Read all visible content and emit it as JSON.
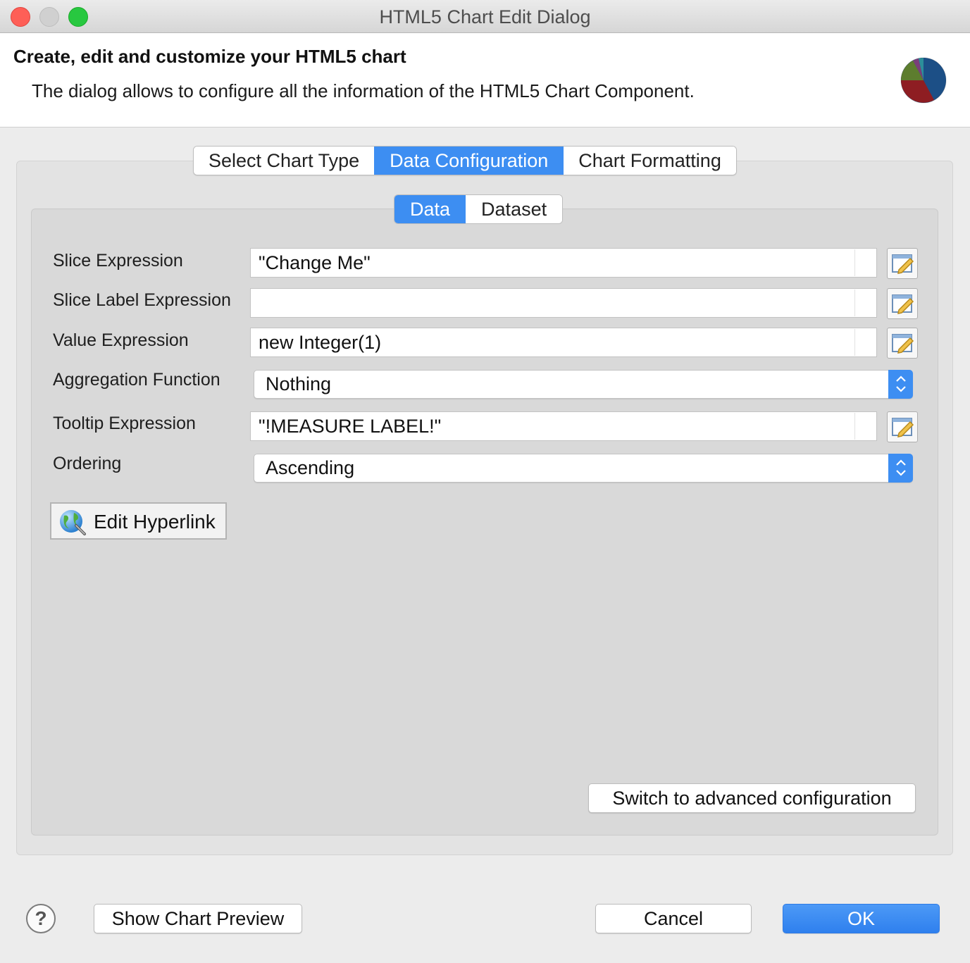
{
  "window": {
    "title": "HTML5 Chart Edit Dialog"
  },
  "header": {
    "title": "Create, edit and customize your HTML5 chart",
    "description": "The dialog allows to configure all the information of the HTML5 Chart Component."
  },
  "tabs": [
    {
      "label": "Select Chart Type",
      "active": false
    },
    {
      "label": "Data Configuration",
      "active": true
    },
    {
      "label": "Chart Formatting",
      "active": false
    }
  ],
  "subtabs": [
    {
      "label": "Data",
      "active": true
    },
    {
      "label": "Dataset",
      "active": false
    }
  ],
  "form": {
    "slice_expression": {
      "label": "Slice Expression",
      "value": "\"Change Me\""
    },
    "slice_label_expression": {
      "label": "Slice Label Expression",
      "value": ""
    },
    "value_expression": {
      "label": "Value Expression",
      "value": "new Integer(1)"
    },
    "aggregation_function": {
      "label": "Aggregation Function",
      "value": "Nothing"
    },
    "tooltip_expression": {
      "label": "Tooltip Expression",
      "value": "\"!MEASURE LABEL!\""
    },
    "ordering": {
      "label": "Ordering",
      "value": "Ascending"
    }
  },
  "buttons": {
    "edit_hyperlink": "Edit Hyperlink",
    "switch_advanced": "Switch to advanced configuration",
    "help": "?",
    "show_preview": "Show Chart Preview",
    "cancel": "Cancel",
    "ok": "OK"
  },
  "colors": {
    "accent": "#3d8ef2",
    "close": "#fe5f57",
    "maximize": "#28c840"
  },
  "icons": [
    "pie-chart-logo-icon",
    "expression-edit-icon",
    "select-arrows-icon",
    "globe-link-icon",
    "help-icon"
  ]
}
